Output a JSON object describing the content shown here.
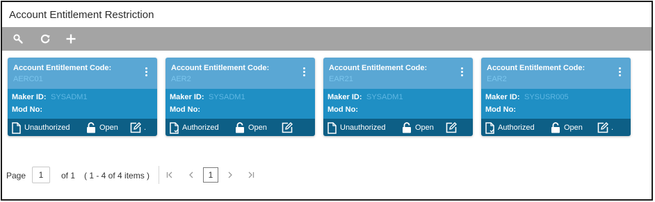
{
  "page": {
    "title": "Account Entitlement Restriction"
  },
  "toolbar": {
    "icons": [
      "search-icon",
      "refresh-icon",
      "plus-icon"
    ]
  },
  "cards": [
    {
      "code_label": "Account Entitlement Code:",
      "code_value": "AERC01",
      "maker_label": "Maker ID:",
      "maker_value": "SYSADM1",
      "mod_label": "Mod No:",
      "status": "Unauthorized",
      "lock": "Open"
    },
    {
      "code_label": "Account Entitlement Code:",
      "code_value": "AER2",
      "maker_label": "Maker ID:",
      "maker_value": "SYSADM1",
      "mod_label": "Mod No:",
      "status": "Authorized",
      "lock": "Open"
    },
    {
      "code_label": "Account Entitlement Code:",
      "code_value": "EAR21",
      "maker_label": "Maker ID:",
      "maker_value": "SYSADM1",
      "mod_label": "Mod No:",
      "status": "Unauthorized",
      "lock": "Open"
    },
    {
      "code_label": "Account Entitlement Code:",
      "code_value": "EAR2",
      "maker_label": "Maker ID:",
      "maker_value": "SYSUSR005",
      "mod_label": "Mod No:",
      "status": "Authorized",
      "lock": "Open"
    }
  ],
  "pagination": {
    "page_label": "Page",
    "page_input": "1",
    "of_label": "of 1",
    "items_label": "( 1 - 4 of 4 items )",
    "current_page": "1"
  }
}
